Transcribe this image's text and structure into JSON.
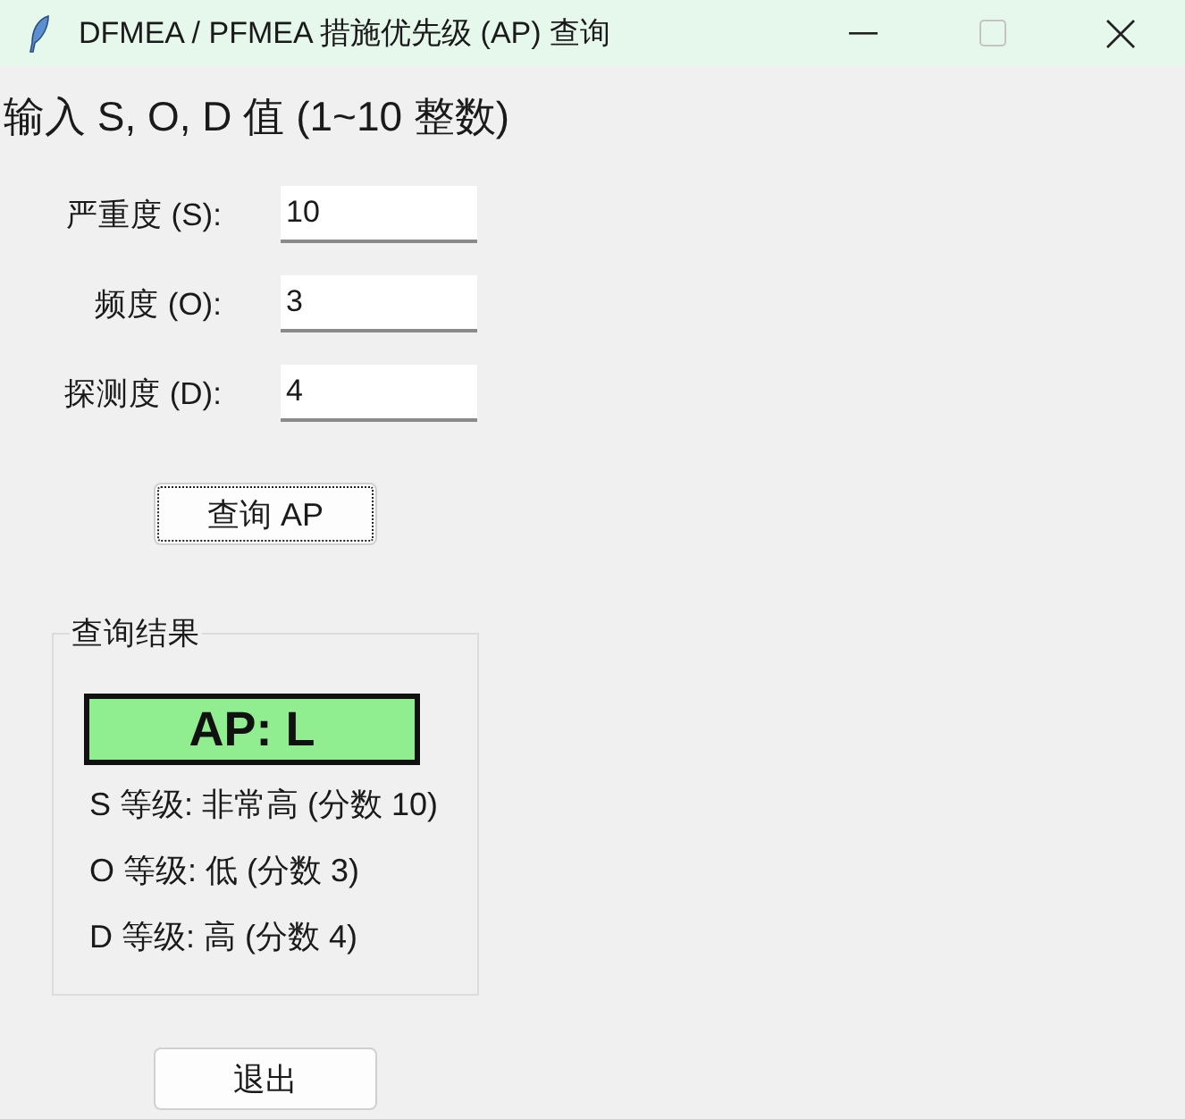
{
  "window": {
    "title": "DFMEA / PFMEA 措施优先级 (AP) 查询",
    "maximize_disabled": true
  },
  "heading": "输入 S, O, D 值 (1~10 整数)",
  "fields": [
    {
      "label": "严重度 (S):",
      "value": "10"
    },
    {
      "label": "频度 (O):",
      "value": "3"
    },
    {
      "label": "探测度 (D):",
      "value": "4"
    }
  ],
  "query_button": {
    "label": "查询 AP",
    "focused": true
  },
  "result": {
    "title": "查询结果",
    "ap": "AP: L",
    "lines": [
      "S 等级: 非常高 (分数 10)",
      "O 等级: 低 (分数 3)",
      "D 等级: 高 (分数 4)"
    ]
  },
  "exit_button": {
    "label": "退出",
    "focused": false
  }
}
